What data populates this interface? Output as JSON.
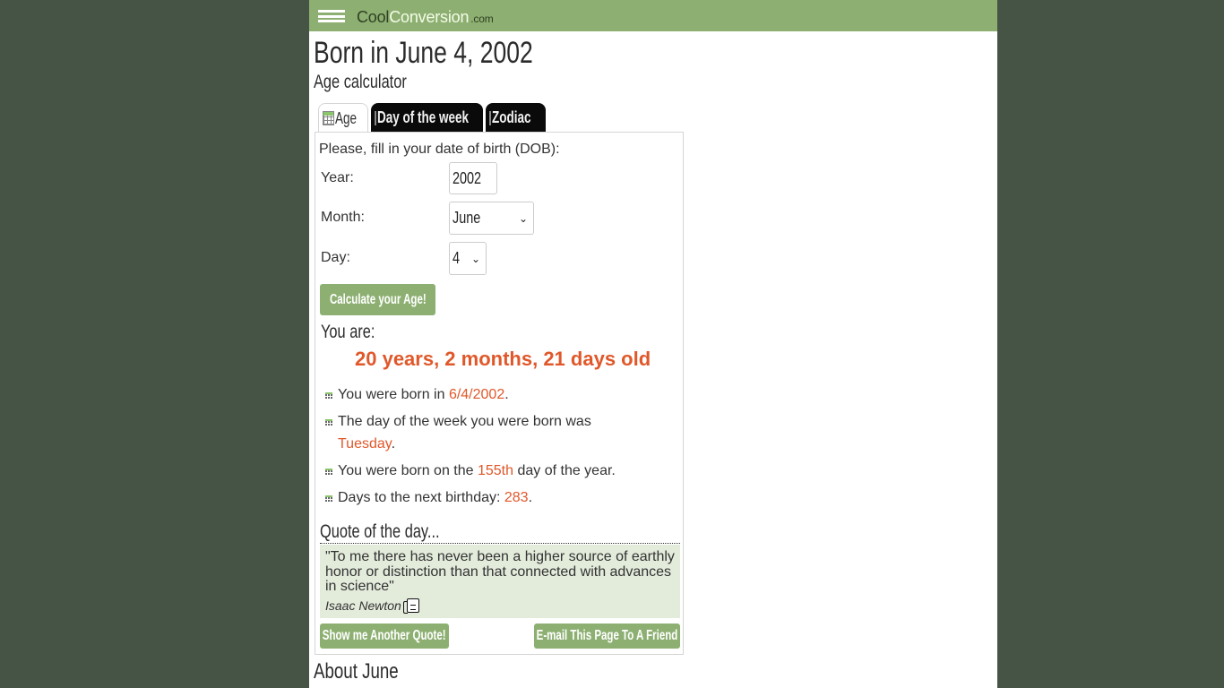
{
  "header": {
    "logo_part1": "Cool",
    "logo_part2": "Conversion",
    "logo_part3": ".com",
    "menu_icon": "hamburger-icon"
  },
  "page": {
    "title": "Born in June 4, 2002",
    "subtitle": "Age calculator"
  },
  "tabs": [
    {
      "label": "Age",
      "icon": "calculator-icon",
      "active": true
    },
    {
      "label": "Day of the week",
      "icon": "calculator-icon",
      "active": false
    },
    {
      "label": "Zodiac",
      "icon": "calculator-icon",
      "active": false
    }
  ],
  "form": {
    "intro": "Please, fill in your date of birth (DOB):",
    "year_label": "Year:",
    "year_value": "2002",
    "month_label": "Month:",
    "month_value": "June",
    "day_label": "Day:",
    "day_value": "4",
    "submit_label": "Calculate your Age!"
  },
  "result": {
    "heading": "You are:",
    "age": "20 years, 2 months, 21 days old",
    "facts": [
      {
        "prefix": "You were born in ",
        "value": "6/4/2002",
        "suffix": "."
      },
      {
        "prefix": " The day of the week you were born was ",
        "value": "Tuesday",
        "suffix": "."
      },
      {
        "prefix": " You were born on the ",
        "value": "155th",
        "suffix": " day of the year."
      },
      {
        "prefix": " Days to the next birthday: ",
        "value": "283",
        "suffix": "."
      }
    ]
  },
  "quote": {
    "title": "Quote of the day...",
    "text": "\"To me there has never been a higher source of earthly honor or distinction than that connected with advances in science\"",
    "author": "Isaac Newton",
    "another_label": "Show me Another Quote!",
    "email_label": "E-mail This Page To A Friend"
  },
  "about": {
    "title": "About June"
  },
  "colors": {
    "brand_green": "#8db072",
    "highlight": "#e0582a",
    "background": "#465446",
    "quote_bg": "#e3ebdb"
  }
}
